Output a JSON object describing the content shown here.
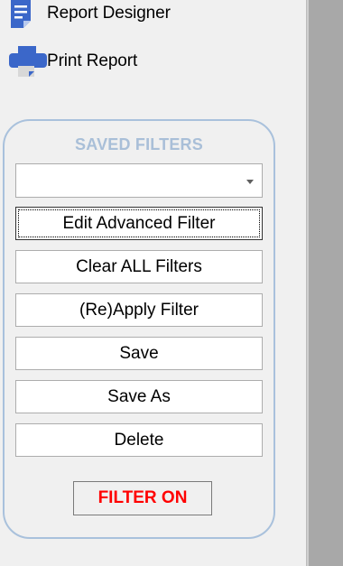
{
  "menu": {
    "report_designer": {
      "label": "Report Designer",
      "icon": "report-designer-icon"
    },
    "print_report": {
      "label": "Print Report",
      "icon": "printer-icon"
    }
  },
  "saved_filters": {
    "title": "SAVED FILTERS",
    "combo_value": "",
    "buttons": {
      "edit_advanced": "Edit Advanced Filter",
      "clear_all": "Clear ALL Filters",
      "reapply": "(Re)Apply Filter",
      "save": "Save",
      "save_as": "Save As",
      "delete": "Delete"
    },
    "status": {
      "label": "FILTER ON",
      "color": "#ff0000"
    }
  },
  "colors": {
    "accent_blue": "#3b67c9",
    "group_border": "#a9c1dc",
    "right_pane": "#a8a8a8"
  }
}
